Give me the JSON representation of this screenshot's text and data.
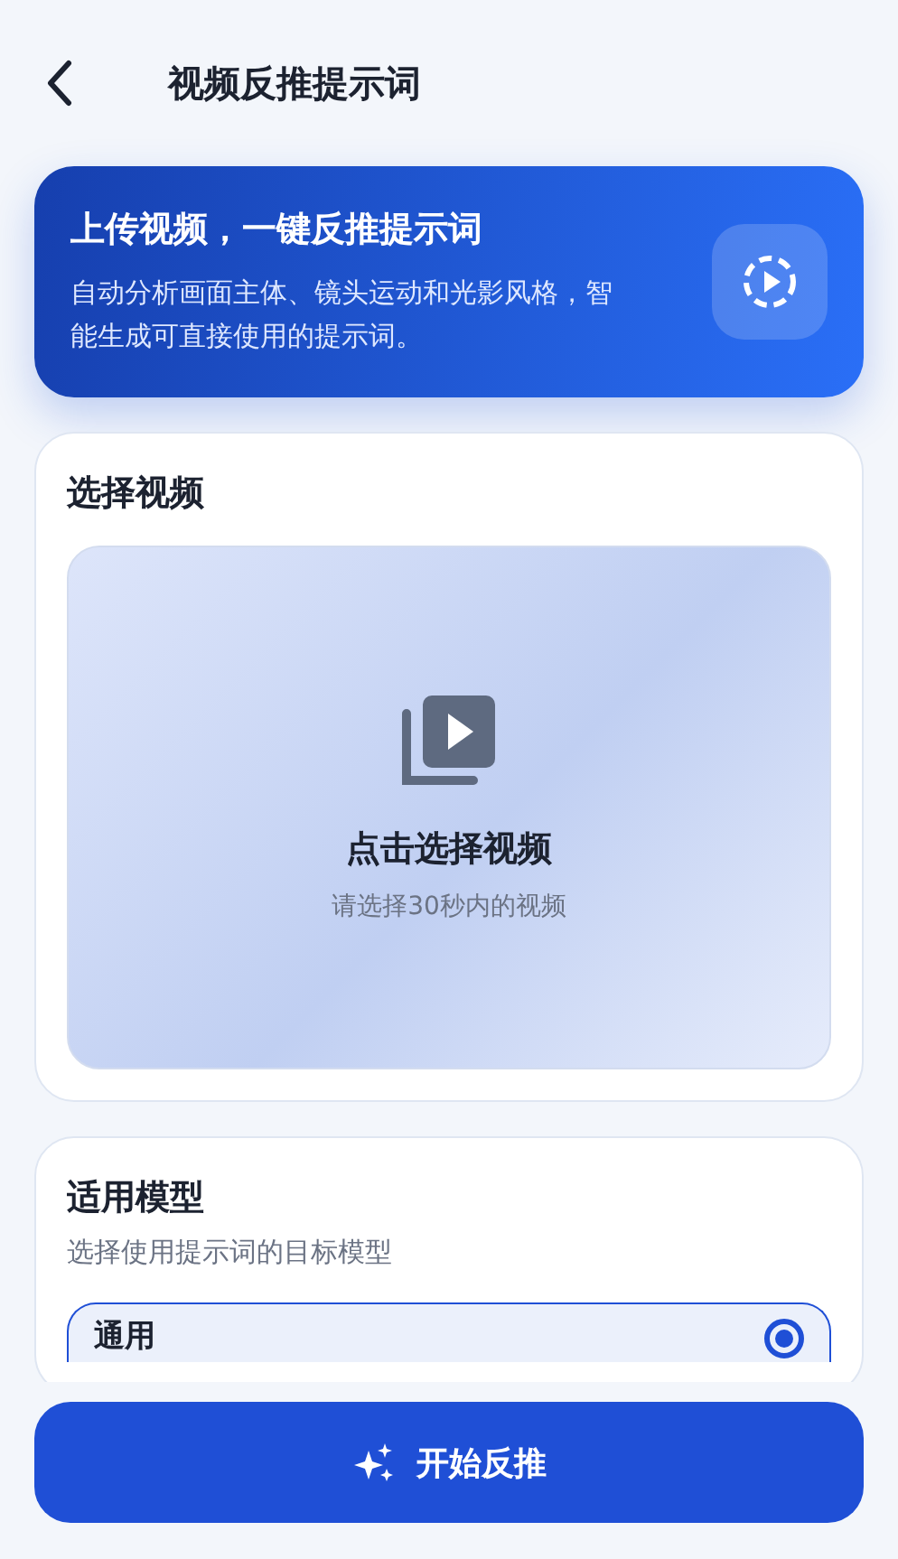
{
  "header": {
    "title": "视频反推提示词"
  },
  "hero": {
    "title": "上传视频，一键反推提示词",
    "description": "自动分析画面主体、镜头运动和光影风格，智能生成可直接使用的提示词。"
  },
  "video_section": {
    "title": "选择视频",
    "upload": {
      "label": "点击选择视频",
      "hint": "请选择30秒内的视频"
    }
  },
  "model_section": {
    "title": "适用模型",
    "subtitle": "选择使用提示词的目标模型",
    "options": [
      {
        "label": "通用",
        "selected": true
      }
    ]
  },
  "action_button": {
    "label": "开始反推"
  }
}
